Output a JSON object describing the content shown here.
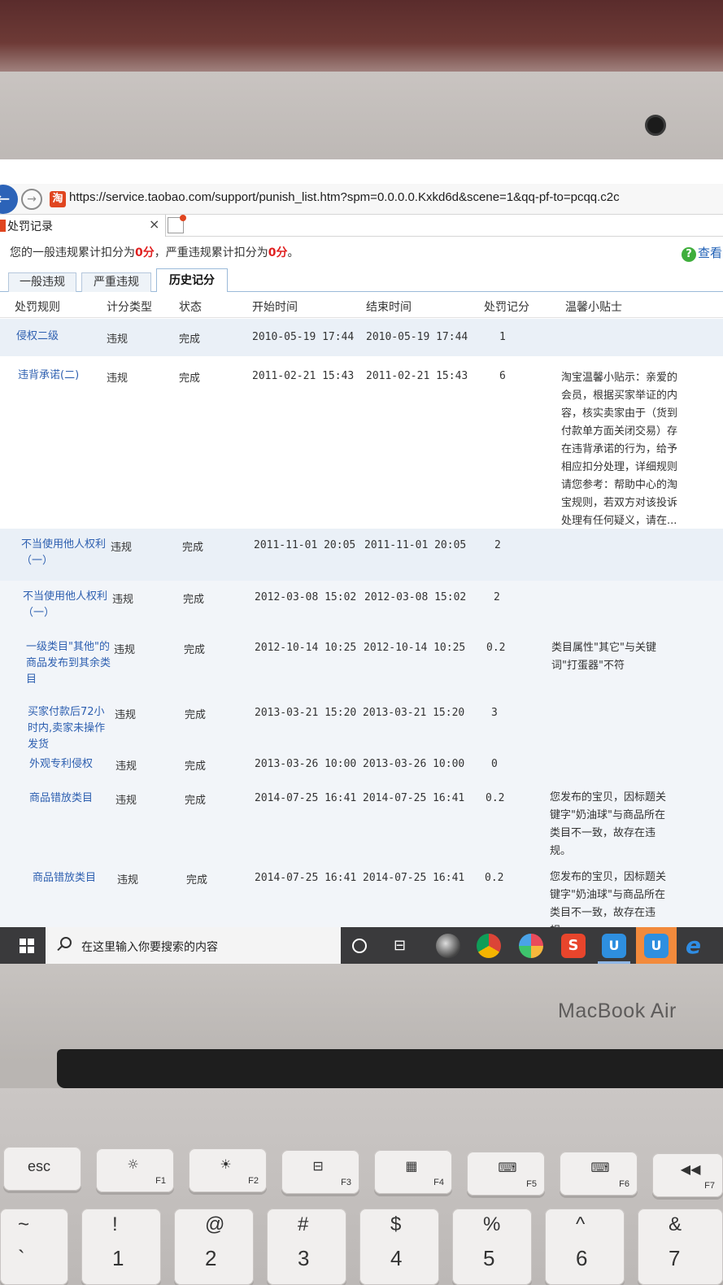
{
  "device": {
    "brand": "MacBook Air"
  },
  "browser": {
    "url": "https://service.taobao.com/support/punish_list.htm?spm=0.0.0.0.Kxkd6d&scene=1&qq-pf-to=pcqq.c2c",
    "tab_title": "处罚记录",
    "tab_close": "×",
    "back_glyph": "←",
    "forward_glyph": "→",
    "site_glyph": "淘"
  },
  "summary": {
    "part1": "您的一般违规累计扣分为",
    "general_points": "0分",
    "part2": "，严重违规累计扣分为",
    "serious_points": "0分",
    "part3": "。",
    "help_link": "查看",
    "help_icon": "?"
  },
  "tabs": [
    {
      "label": "一般违规",
      "active": false
    },
    {
      "label": "严重违规",
      "active": false
    },
    {
      "label": "历史记分",
      "active": true
    }
  ],
  "table": {
    "headers": [
      "处罚规则",
      "计分类型",
      "状态",
      "开始时间",
      "结束时间",
      "处罚记分",
      "温馨小贴士"
    ],
    "rows": [
      {
        "rule": "侵权二级",
        "type": "违规",
        "status": "完成",
        "start": "2010-05-19 17:44",
        "end": "2010-05-19 17:44",
        "points": "1",
        "tip": ""
      },
      {
        "rule": "违背承诺(二)",
        "type": "违规",
        "status": "完成",
        "start": "2011-02-21 15:43",
        "end": "2011-02-21 15:43",
        "points": "6",
        "tip": "淘宝温馨小贴示：亲爱的会员，根据买家举证的内容，核实卖家由于（货到付款单方面关闭交易）存在违背承诺的行为，给予相应扣分处理，详细规则请您参考：帮助中心的淘宝规则，若双方对该投诉处理有任何疑义，请在..."
      },
      {
        "rule": "不当使用他人权利（一）",
        "type": "违规",
        "status": "完成",
        "start": "2011-11-01 20:05",
        "end": "2011-11-01 20:05",
        "points": "2",
        "tip": ""
      },
      {
        "rule": "不当使用他人权利（一）",
        "type": "违规",
        "status": "完成",
        "start": "2012-03-08 15:02",
        "end": "2012-03-08 15:02",
        "points": "2",
        "tip": ""
      },
      {
        "rule": "一级类目\"其他\"的商品发布到其余类目",
        "type": "违规",
        "status": "完成",
        "start": "2012-10-14 10:25",
        "end": "2012-10-14 10:25",
        "points": "0.2",
        "tip": "类目属性\"其它\"与关键词\"打蛋器\"不符"
      },
      {
        "rule": "买家付款后72小时内,卖家未操作发货",
        "type": "违规",
        "status": "完成",
        "start": "2013-03-21 15:20",
        "end": "2013-03-21 15:20",
        "points": "3",
        "tip": ""
      },
      {
        "rule": "外观专利侵权",
        "type": "违规",
        "status": "完成",
        "start": "2013-03-26 10:00",
        "end": "2013-03-26 10:00",
        "points": "0",
        "tip": ""
      },
      {
        "rule": "商品错放类目",
        "type": "违规",
        "status": "完成",
        "start": "2014-07-25 16:41",
        "end": "2014-07-25 16:41",
        "points": "0.2",
        "tip": "您发布的宝贝，因标题关键字\"奶油球\"与商品所在类目不一致，故存在违规。"
      },
      {
        "rule": "商品错放类目",
        "type": "违规",
        "status": "完成",
        "start": "2014-07-25 16:41",
        "end": "2014-07-25 16:41",
        "points": "0.2",
        "tip": "您发布的宝贝，因标题关键字\"奶油球\"与商品所在类目不一致，故存在违规。"
      }
    ]
  },
  "taskbar": {
    "search_placeholder": "在这里输入你要搜索的内容",
    "apps": [
      "photos-app",
      "chrome",
      "pinwheel-app",
      "sogou-input",
      "ali-wangwang",
      "ali-wangwang",
      "internet-explorer"
    ]
  },
  "keyboard": {
    "function_row": [
      {
        "cap": "esc",
        "fn": ""
      },
      {
        "cap": "☼",
        "fn": "F1"
      },
      {
        "cap": "☀",
        "fn": "F2"
      },
      {
        "cap": "⊟",
        "fn": "F3"
      },
      {
        "cap": "▦",
        "fn": "F4"
      },
      {
        "cap": "⌨",
        "fn": "F5"
      },
      {
        "cap": "⌨",
        "fn": "F6"
      },
      {
        "cap": "◀◀",
        "fn": "F7"
      }
    ],
    "number_row": [
      {
        "top": "~",
        "bottom": "`"
      },
      {
        "top": "!",
        "bottom": "1"
      },
      {
        "top": "@",
        "bottom": "2"
      },
      {
        "top": "#",
        "bottom": "3"
      },
      {
        "top": "$",
        "bottom": "4"
      },
      {
        "top": "%",
        "bottom": "5"
      },
      {
        "top": "^",
        "bottom": "6"
      },
      {
        "top": "&",
        "bottom": "7"
      }
    ]
  },
  "colors": {
    "link": "#2d5fb0",
    "highlight_red": "#e02020",
    "tab_border": "#9bbad9",
    "row_shade": "#eaf0f7",
    "taskbar": "#3a3a3c"
  }
}
